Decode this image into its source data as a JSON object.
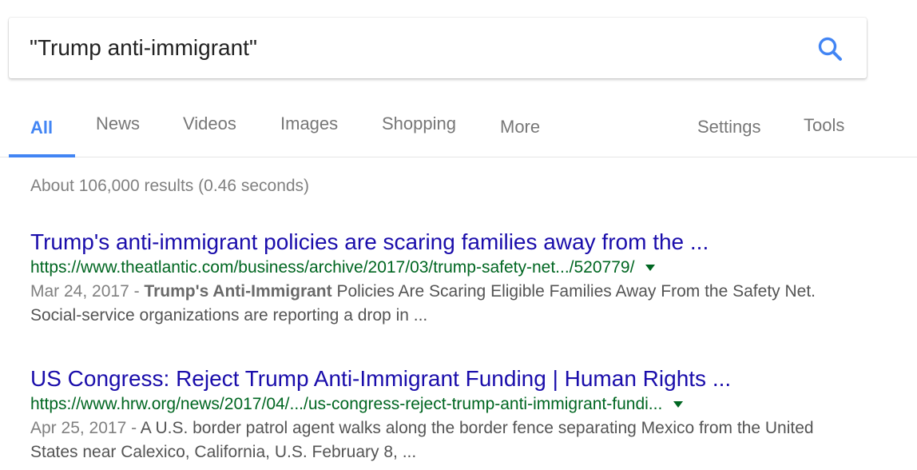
{
  "search": {
    "query": "\"Trump anti-immigrant\"",
    "button_icon": "search-icon",
    "accent_color": "#4285f4"
  },
  "tabs": {
    "all": "All",
    "news": "News",
    "videos": "Videos",
    "images": "Images",
    "shopping": "Shopping",
    "more": "More",
    "settings": "Settings",
    "tools": "Tools",
    "active": "All"
  },
  "results_stats": "About 106,000 results (0.46 seconds)",
  "results": [
    {
      "title": "Trump's anti-immigrant policies are scaring families away from the ...",
      "url": "https://www.theatlantic.com/business/archive/2017/03/trump-safety-net.../520779/",
      "date": "Mar 24, 2017 - ",
      "snippet_bold": "Trump's Anti-Immigrant",
      "snippet_rest": " Policies Are Scaring Eligible Families Away From the Safety Net. Social-service organizations are reporting a drop in ..."
    },
    {
      "title": "US Congress: Reject Trump Anti-Immigrant Funding | Human Rights ...",
      "url": "https://www.hrw.org/news/2017/04/.../us-congress-reject-trump-anti-immigrant-fundi...",
      "date": "Apr 25, 2017 - ",
      "snippet_bold": "",
      "snippet_rest": "A U.S. border patrol agent walks along the border fence separating Mexico from the United States near Calexico, California, U.S. February 8, ..."
    }
  ],
  "colors": {
    "title_link": "#1a0dab",
    "url_green": "#006621",
    "snippet_gray": "#545454"
  }
}
